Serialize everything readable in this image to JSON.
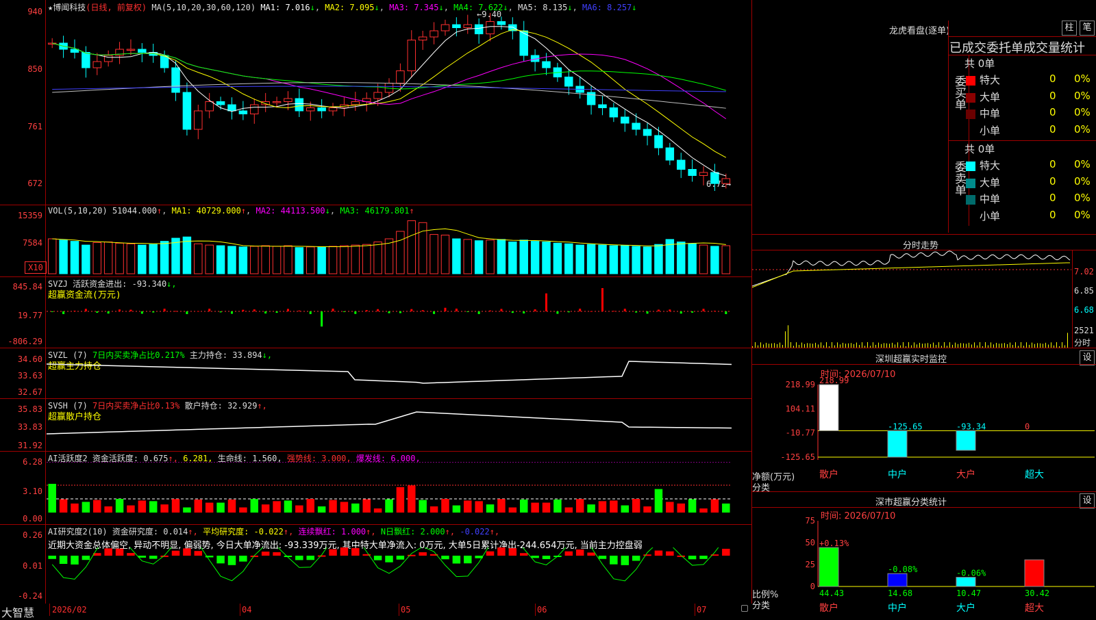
{
  "stock": {
    "title": "★博闻科技",
    "period": "(日线, 前复权)",
    "ma_label": "MA(5,10,20,30,60,120)",
    "ma1": "MA1: 7.016",
    "ma2": "MA2: 7.095",
    "ma3": "MA3: 7.345",
    "ma4": "MA4: 7.622",
    "ma5": "MA5: 8.135",
    "ma6": "MA6: 8.257",
    "high_mark": "9.40",
    "low_mark": "6.72",
    "y_ticks": [
      "940",
      "850",
      "761",
      "672"
    ],
    "arrows": [
      "↓",
      "↓",
      "↓",
      "↓",
      "↓",
      "↓"
    ]
  },
  "vol": {
    "label": "VOL(5,10,20)",
    "value": "51044.000",
    "ma1": "MA1: 40729.000",
    "ma2": "MA2: 44113.500",
    "ma3": "MA3: 46179.801",
    "y_ticks": [
      "15359",
      "7584"
    ],
    "unit": "X10",
    "up": "↑",
    "down": "↓"
  },
  "svzj": {
    "label": "SVZJ",
    "desc": "活跃资金进出: -93.340",
    "sub": "超赢资金流(万元)",
    "y_ticks": [
      "845.84",
      "19.77",
      "-806.29"
    ],
    "down": "↓,"
  },
  "svzl": {
    "label": "SVZL (7)",
    "desc": "7日内买卖净占比0.217%",
    "hold": "主力持仓: 33.894",
    "sub": "超赢主力持仓",
    "y_ticks": [
      "34.60",
      "33.63",
      "32.67"
    ],
    "down": "↓,"
  },
  "svsh": {
    "label": "SVSH (7)",
    "desc": "7日内买卖净占比0.13%",
    "hold": "散户持仓: 32.929",
    "sub": "超赢散户持仓",
    "y_ticks": [
      "35.83",
      "33.83",
      "31.92"
    ],
    "up": "↑,"
  },
  "ai_active": {
    "label": "AI活跃度2",
    "desc": "资金活跃度: 0.675",
    "v2": "6.281,",
    "life": "生命线: 1.560,",
    "strong": "强势线: 3.000,",
    "burst": "爆发线: 6.000,",
    "y_ticks": [
      "6.28",
      "3.10",
      "0.00"
    ],
    "up": "↑,"
  },
  "ai_research": {
    "label": "AI研究度2(10)",
    "desc": "资金研究度: 0.014",
    "avg": "平均研究度: -0.022",
    "red": "连续飘红: 1.000",
    "nred": "N日飘红: 2.000",
    "last": "-0.022",
    "comment": "近期大资金总体偏空, 异动不明显, 偏弱势, 今日大单净流出: -93.339万元, 其中特大单净流入: 0万元, 大单5日累计净出-244.654万元, 当前主力控盘弱",
    "y_ticks": [
      "0.26",
      "0.01",
      "-0.24"
    ],
    "up": "↑,"
  },
  "x_axis": {
    "brand": "大智慧",
    "labels": [
      "2026/02",
      "04",
      "05",
      "06",
      "07"
    ]
  },
  "dragon": {
    "title": "龙虎看盘(逐单)",
    "btn_column": "柱",
    "btn_stroke": "笔",
    "header": "已成交委托单成交量统计",
    "buy_side": "委买单",
    "sell_side": "委卖单",
    "total_buy": "共 0单",
    "total_sell": "共 0单",
    "rows_buy": [
      {
        "label": "特大",
        "count": "0",
        "pct": "0%",
        "color": "#ff0000"
      },
      {
        "label": "大单",
        "count": "0",
        "pct": "0%",
        "color": "#8b0000"
      },
      {
        "label": "中单",
        "count": "0",
        "pct": "0%",
        "color": "#6b0000"
      },
      {
        "label": "小单",
        "count": "0",
        "pct": "0%",
        "color": ""
      }
    ],
    "rows_sell": [
      {
        "label": "特大",
        "count": "0",
        "pct": "0%",
        "color": "#00ffff"
      },
      {
        "label": "大单",
        "count": "0",
        "pct": "0%",
        "color": "#008b8b"
      },
      {
        "label": "中单",
        "count": "0",
        "pct": "0%",
        "color": "#006b6b"
      },
      {
        "label": "小单",
        "count": "0",
        "pct": "0%",
        "color": ""
      }
    ]
  },
  "intraday": {
    "title": "分时走势",
    "y_ticks": [
      "7.02",
      "6.85",
      "6.68"
    ],
    "vol": "2521",
    "vol_unit": "分时"
  },
  "monitor": {
    "title": "深圳超赢实时监控",
    "set": "设",
    "time": "时间: 2026/07/10",
    "y_ticks": [
      "218.99",
      "104.11",
      "-10.77",
      "-125.65"
    ],
    "axis_label": "净额(万元)",
    "axis_sub": "分类",
    "bars": [
      {
        "label": "散户",
        "value": 218.99,
        "text": "218.99",
        "color": "#ffffff"
      },
      {
        "label": "中户",
        "value": -125.65,
        "text": "-125.65",
        "color": "#00ffff"
      },
      {
        "label": "大户",
        "value": -93.34,
        "text": "-93.34",
        "color": "#00ffff"
      },
      {
        "label": "超大",
        "value": 0,
        "text": "0",
        "color": "#ffffff"
      }
    ]
  },
  "classify": {
    "title": "深市超赢分类统计",
    "set": "设",
    "time": "时间: 2026/07/10",
    "y_ticks": [
      "75",
      "50",
      "25",
      "0"
    ],
    "axis_label": "比例%",
    "axis_sub": "分类",
    "bars": [
      {
        "label": "散户",
        "value": 44.43,
        "delta": "+0.13%",
        "color": "#00ff00"
      },
      {
        "label": "中户",
        "value": 14.68,
        "delta": "-0.08%",
        "color": "#0000ff"
      },
      {
        "label": "大户",
        "value": 10.47,
        "delta": "-0.06%",
        "color": "#00ffff"
      },
      {
        "label": "超大",
        "value": 30.42,
        "delta": "",
        "color": "#ff0000"
      }
    ]
  },
  "chart_data": {
    "type": "candlestick",
    "title": "博闻科技",
    "ylim": [
      6.5,
      9.5
    ],
    "candles_close": [
      9.0,
      8.9,
      8.85,
      8.6,
      8.7,
      8.8,
      8.9,
      8.9,
      8.85,
      8.8,
      8.6,
      8.2,
      7.6,
      7.9,
      8.05,
      8.0,
      7.9,
      7.85,
      8.0,
      8.05,
      8.05,
      8.1,
      7.9,
      7.95,
      7.9,
      7.95,
      8.0,
      8.05,
      8.1,
      8.2,
      8.35,
      8.55,
      9.05,
      9.1,
      9.2,
      9.3,
      9.25,
      9.3,
      9.15,
      9.35,
      9.3,
      9.2,
      8.8,
      8.7,
      8.6,
      8.45,
      8.3,
      8.2,
      8.0,
      7.95,
      7.8,
      7.7,
      7.6,
      7.5,
      7.3,
      7.1,
      6.95,
      6.85,
      6.9,
      6.72,
      6.8
    ],
    "volume": [
      5600,
      5400,
      5200,
      4600,
      5000,
      5100,
      4900,
      4800,
      4600,
      4700,
      5200,
      5700,
      5900,
      4800,
      4600,
      4500,
      4400,
      4300,
      4400,
      4500,
      4400,
      4500,
      4200,
      4300,
      4300,
      4400,
      4500,
      4600,
      4700,
      5100,
      5600,
      6800,
      8500,
      8200,
      6300,
      6200,
      5600,
      5500,
      5300,
      5400,
      5500,
      5100,
      5400,
      5200,
      5100,
      4900,
      4800,
      4600,
      4700,
      4600,
      4500,
      4500,
      4400,
      4300,
      4700,
      5500,
      5100,
      4800,
      4600,
      4400,
      4500
    ]
  }
}
